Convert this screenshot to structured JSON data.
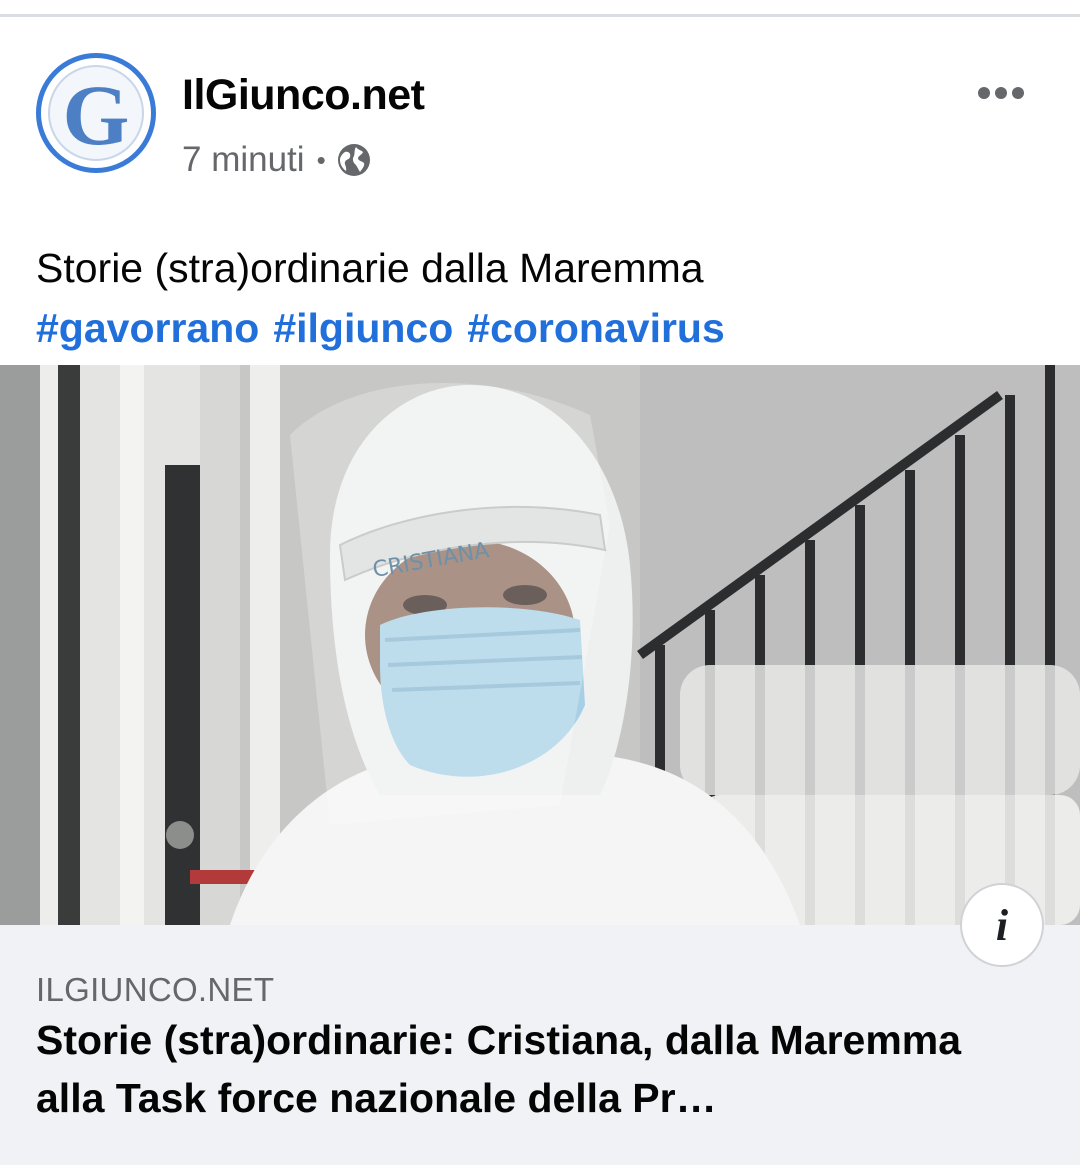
{
  "post": {
    "page_name": "IlGiunco.net",
    "avatar_letter": "G",
    "time_ago": "7 minuti",
    "separator": "•",
    "privacy_icon": "globe-icon",
    "more_icon": "more-horizontal-icon",
    "text": "Storie (stra)ordinarie dalla Maremma",
    "hashtags": [
      "#gavorrano",
      "#ilgiunco",
      "#coronavirus"
    ]
  },
  "photo": {
    "description_icon": "photo-of-healthcare-worker-in-protective-suit",
    "headband_text": "CRISTIANA"
  },
  "link_preview": {
    "info_icon": "info-icon",
    "info_letter": "i",
    "domain": "ILGIUNCO.NET",
    "title": "Storie (stra)ordinarie: Cristiana, dalla Maremma alla Task force nazionale della Pr…"
  },
  "colors": {
    "link_blue": "#216fdb",
    "secondary_text": "#65676b",
    "primary_text": "#050505",
    "card_background": "#f0f2f5",
    "avatar_ring": "#3b7bd8"
  }
}
